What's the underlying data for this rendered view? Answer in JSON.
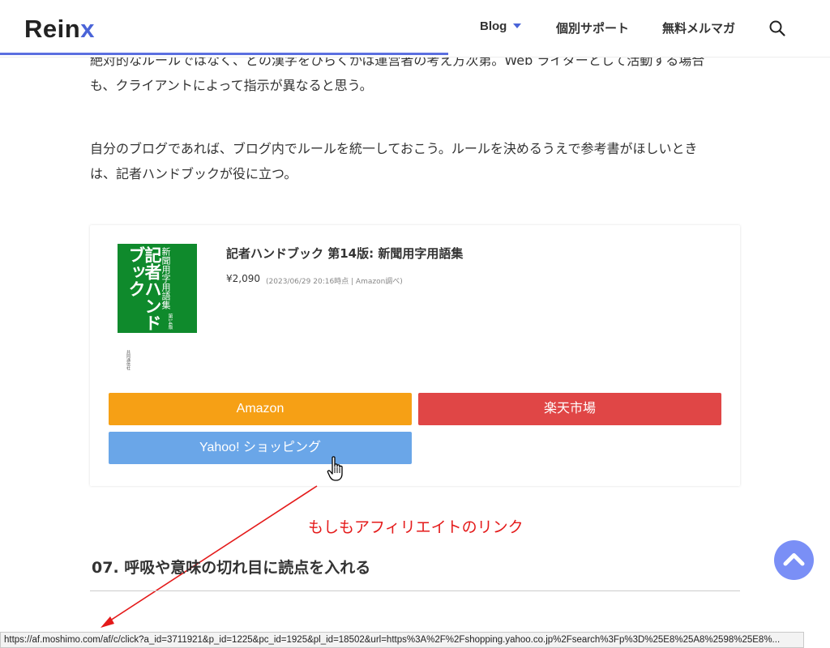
{
  "header": {
    "logo_main": "Rein",
    "logo_accent": "x",
    "nav": [
      {
        "label": "Blog"
      },
      {
        "label": "個別サポート"
      },
      {
        "label": "無料メルマガ"
      }
    ],
    "read_progress_percent": 54
  },
  "article": {
    "paragraph1_line1": "絶対的なルールではなく、どの漢字をひらくかは運営者の考え方次第。Web ライターとして活動する場合",
    "paragraph1_line2": "も、クライアントによって指示が異なると思う。",
    "paragraph2_line1": "自分のブログであれば、ブログ内でルールを統一しておこう。ルールを決めるうえで参考書がほしいとき",
    "paragraph2_line2": "は、記者ハンドブックが役に立つ。",
    "next_heading": "07. 呼吸や意味の切れ目に読点を入れる"
  },
  "product": {
    "cover_title": "記者ハンドブック",
    "cover_subtitle": "新聞用字用語集",
    "cover_edition": "第14版",
    "publisher": "共同通信社",
    "title": "記者ハンドブック 第14版: 新聞用字用語集",
    "price": "¥2,090",
    "price_note": "(2023/06/29 20:16時点 | Amazon調べ)",
    "buttons": {
      "amazon": "Amazon",
      "rakuten": "楽天市場",
      "yahoo": "Yahoo! ショッピング"
    }
  },
  "annotation": {
    "text": "もしもアフィリエイトのリンク",
    "color": "#e41a1a"
  },
  "status_bar": {
    "url": "https://af.moshimo.com/af/c/click?a_id=3711921&p_id=1225&pc_id=1925&pl_id=18502&url=https%3A%2F%2Fshopping.yahoo.co.jp%2Fsearch%3Fp%3D%25E8%25A8%2598%25E8%..."
  },
  "colors": {
    "accent": "#4a64d8",
    "amazon": "#f6a015",
    "rakuten": "#e04646",
    "yahoo": "#6aa6e8",
    "cover_green": "#0f8a2c"
  }
}
